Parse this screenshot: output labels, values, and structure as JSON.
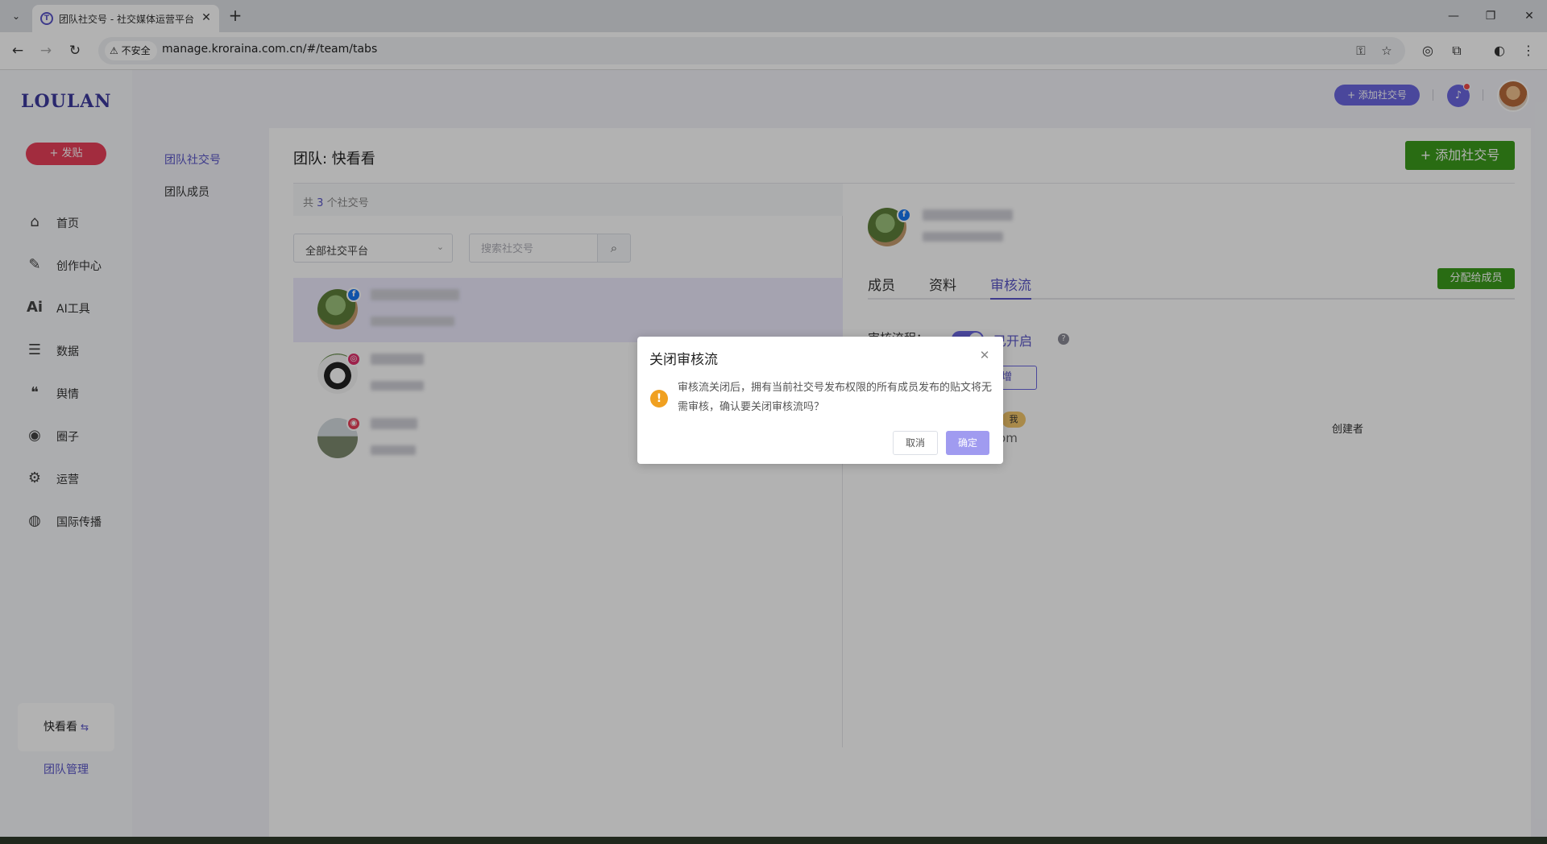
{
  "browser": {
    "tab_title": "团队社交号 - 社交媒体运营平台",
    "insecure_label": "不安全",
    "url": "manage.kroraina.com.cn/#/team/tabs"
  },
  "sidebar": {
    "logo": "LOULAN",
    "post_button": "+ 发贴",
    "items": [
      {
        "label": "首页",
        "icon": "home-icon"
      },
      {
        "label": "创作中心",
        "icon": "palette-icon"
      },
      {
        "label": "AI工具",
        "icon": "ai-icon"
      },
      {
        "label": "数据",
        "icon": "database-icon"
      },
      {
        "label": "舆情",
        "icon": "quote-icon"
      },
      {
        "label": "圈子",
        "icon": "compass-icon"
      },
      {
        "label": "运营",
        "icon": "settings-icon"
      },
      {
        "label": "国际传播",
        "icon": "globe-icon"
      }
    ],
    "team_name": "快看看",
    "team_manage": "团队管理"
  },
  "header": {
    "add_account": "+ 添加社交号"
  },
  "subnav": {
    "items": [
      {
        "label": "团队社交号",
        "active": true
      },
      {
        "label": "团队成员",
        "active": false
      }
    ]
  },
  "main": {
    "title": "团队: 快看看",
    "add_button": "+ 添加社交号",
    "count_prefix": "共",
    "count_value": "3",
    "count_suffix": "个社交号",
    "platform_select": "全部社交平台",
    "search_placeholder": "搜索社交号",
    "accounts": [
      {
        "platform": "facebook",
        "badge_color": "#1877f2"
      },
      {
        "platform": "instagram",
        "badge_color": "#e1306c"
      },
      {
        "platform": "other",
        "badge_color": "#e8405a"
      }
    ],
    "detail": {
      "tabs": [
        {
          "label": "成员",
          "active": false
        },
        {
          "label": "资料",
          "active": false
        },
        {
          "label": "审核流",
          "active": true
        }
      ],
      "assign_button": "分配给成员",
      "flow_label": "审核流程：",
      "flow_state": "已开启",
      "add_reviewer_fragment": "增",
      "member_tag": "我",
      "member_email_fragment": "qq.com",
      "member_role": "创建者"
    }
  },
  "dialog": {
    "title": "关闭审核流",
    "message": "审核流关闭后，拥有当前社交号发布权限的所有成员发布的贴文将无需审核，确认要关闭审核流吗？",
    "cancel": "取消",
    "confirm": "确定"
  }
}
